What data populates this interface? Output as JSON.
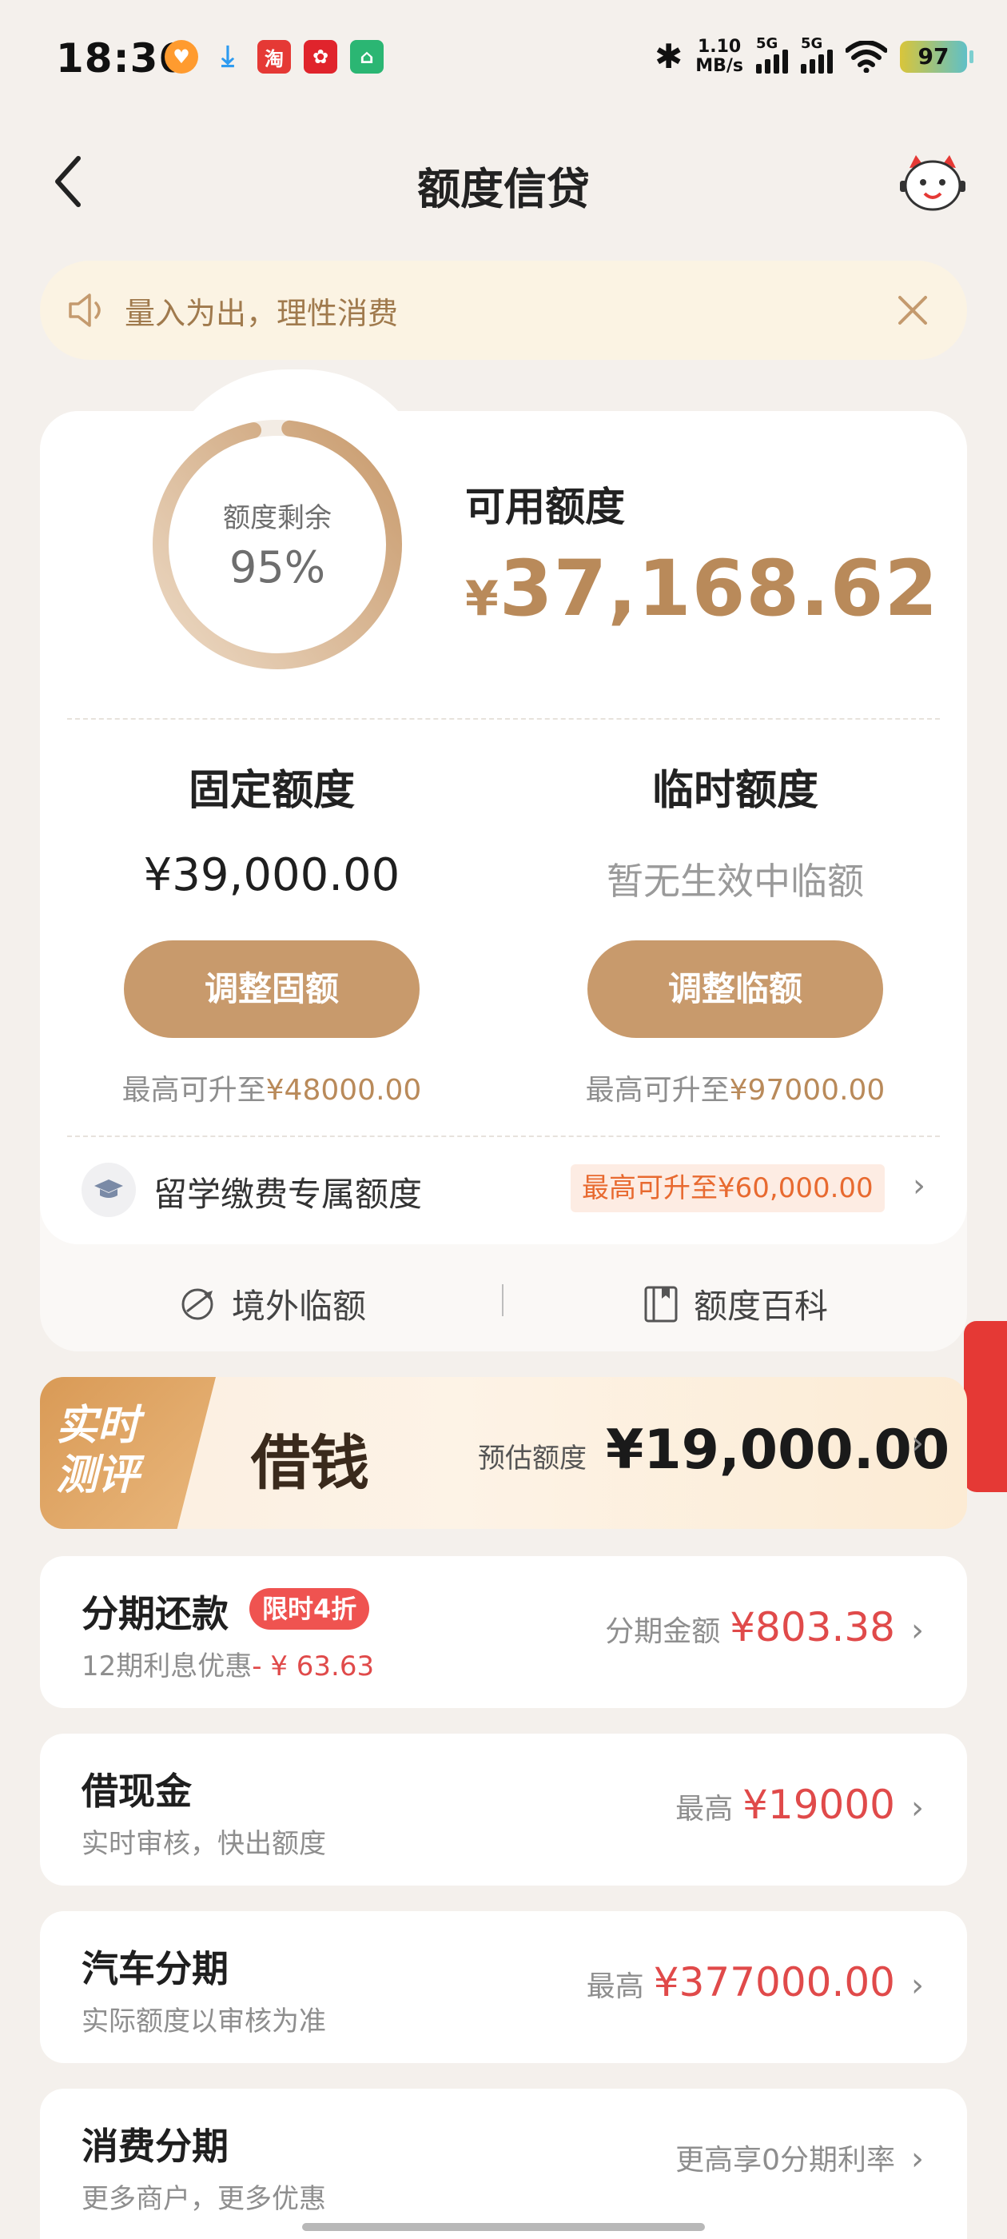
{
  "status_bar": {
    "time": "18:36",
    "net_speed_value": "1.10",
    "net_speed_unit": "MB/s",
    "sim1": "5G",
    "sim2": "5G",
    "battery": "97"
  },
  "header": {
    "title": "额度信贷"
  },
  "notice": {
    "text": "量入为出，理性消费"
  },
  "credit": {
    "ring_label": "额度剩余",
    "ring_percent": "95%",
    "ring_fraction": 0.95,
    "available_label": "可用额度",
    "available_currency": "¥",
    "available_amount": "37,168.62",
    "fixed": {
      "title": "固定额度",
      "value": "¥39,000.00",
      "button": "调整固额",
      "hint_prefix": "最高可升至",
      "hint_value": "¥48000.00"
    },
    "temporary": {
      "title": "临时额度",
      "value": "暂无生效中临额",
      "button": "调整临额",
      "hint_prefix": "最高可升至",
      "hint_value": "¥97000.00"
    },
    "study": {
      "label": "留学缴费专属额度",
      "tag": "最高可升至¥60,000.00"
    },
    "links": {
      "overseas": "境外临额",
      "wiki": "额度百科"
    }
  },
  "loan_banner": {
    "badge_line1": "实时",
    "badge_line2": "测评",
    "title": "借钱",
    "estimate_label": "预估额度",
    "estimate_amount": "¥19,000.00"
  },
  "list": [
    {
      "title": "分期还款",
      "tag": "限时4折",
      "sub": "12期利息优惠",
      "sub_red": "- ¥ 63.63",
      "right_label": "分期金额",
      "right_amount": "¥803.38"
    },
    {
      "title": "借现金",
      "sub": "实时审核，快出额度",
      "right_label": "最高",
      "right_amount": "¥19000"
    },
    {
      "title": "汽车分期",
      "sub": "实际额度以审核为准",
      "right_label": "最高",
      "right_amount": "¥377000.00"
    },
    {
      "title": "消费分期",
      "sub": "更多商户，更多优惠",
      "right_label": "更高享0分期利率"
    }
  ],
  "colors": {
    "gold": "#c89a6c",
    "gold_text": "#b98a5a",
    "red": "#e04a4a",
    "background": "#f4f0ec"
  }
}
